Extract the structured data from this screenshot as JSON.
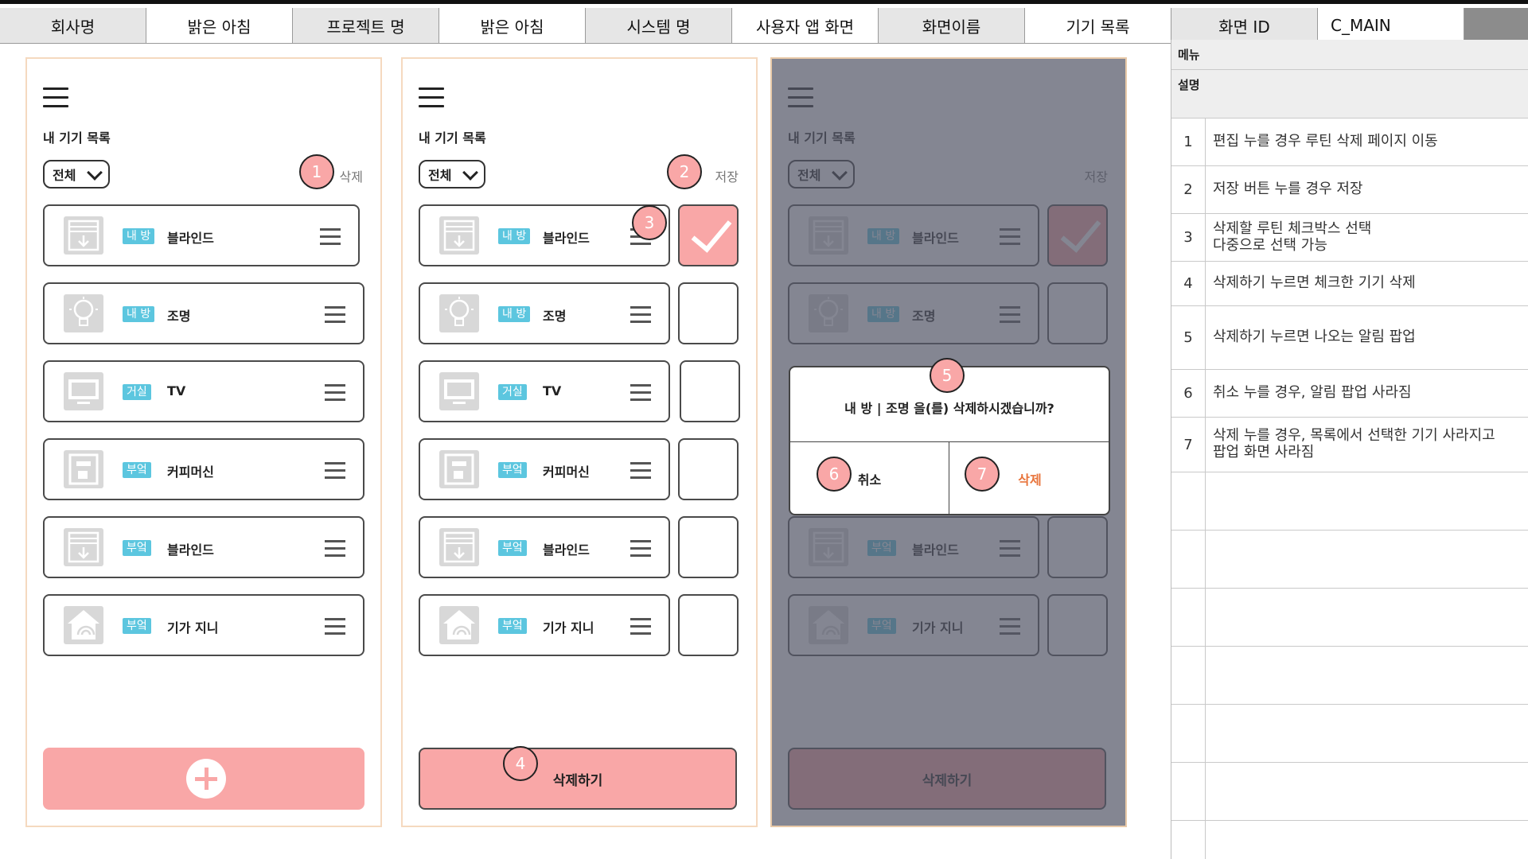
{
  "header": {
    "company_label": "회사명",
    "company_value": "밝은 아침",
    "project_label": "프로젝트 명",
    "project_value": "밝은 아침",
    "system_label": "시스템 명",
    "system_value": "사용자 앱 화면",
    "screen_name_label": "화면이름",
    "screen_name_value": "기기 목록",
    "screen_id_label": "화면 ID",
    "screen_id_value": "C_MAIN"
  },
  "screens": [
    {
      "title": "내 기기 목록",
      "filter": "전체",
      "top_action": "삭제",
      "devices": [
        {
          "room": "내 방",
          "name": "블라인드",
          "icon": "blinds-icon"
        },
        {
          "room": "내 방",
          "name": "조명",
          "icon": "lightbulb-icon"
        },
        {
          "room": "거실",
          "name": "TV",
          "icon": "tv-icon"
        },
        {
          "room": "부엌",
          "name": "커피머신",
          "icon": "coffee-machine-icon"
        },
        {
          "room": "부엌",
          "name": "블라인드",
          "icon": "blinds-icon"
        },
        {
          "room": "부엌",
          "name": "기가 지니",
          "icon": "smart-home-icon"
        }
      ],
      "bottom_button": "add"
    },
    {
      "title": "내 기기 목록",
      "filter": "전체",
      "top_action": "저장",
      "devices": [
        {
          "room": "내 방",
          "name": "블라인드",
          "checked": true
        },
        {
          "room": "내 방",
          "name": "조명",
          "checked": false
        },
        {
          "room": "거실",
          "name": "TV",
          "checked": false
        },
        {
          "room": "부엌",
          "name": "커피머신",
          "checked": false
        },
        {
          "room": "부엌",
          "name": "블라인드",
          "checked": false
        },
        {
          "room": "부엌",
          "name": "기가 지니",
          "checked": false
        }
      ],
      "bottom_button_label": "삭제하기"
    },
    {
      "title": "내 기기 목록",
      "filter": "전체",
      "top_action": "저장",
      "devices": [
        {
          "room": "내 방",
          "name": "블라인드",
          "checked": true
        },
        {
          "room": "내 방",
          "name": "조명",
          "checked": false
        },
        {
          "room": "부엌",
          "name": "블라인드",
          "checked": false
        },
        {
          "room": "부엌",
          "name": "기가 지니",
          "checked": false
        }
      ],
      "bottom_button_label": "삭제하기",
      "dialog": {
        "question": "내 방 | 조명 을(를) 삭제하시겠습니까?",
        "cancel": "취소",
        "confirm": "삭제"
      }
    }
  ],
  "markers": [
    "1",
    "2",
    "3",
    "4",
    "5",
    "6",
    "7"
  ],
  "spec": {
    "menu_label": "메뉴",
    "desc_label": "설명",
    "rows": [
      {
        "num": "1",
        "text": "편집 누를 경우 루틴 삭제 페이지 이동"
      },
      {
        "num": "2",
        "text": "저장 버튼 누를 경우 저장"
      },
      {
        "num": "3",
        "text": "삭제할 루틴 체크박스 선택\n다중으로 선택 가능"
      },
      {
        "num": "4",
        "text": "삭제하기 누르면 체크한 기기 삭제"
      },
      {
        "num": "5",
        "text": "삭제하기 누르면 나오는 알림 팝업"
      },
      {
        "num": "6",
        "text": "취소 누를 경우, 알림 팝업 사라짐"
      },
      {
        "num": "7",
        "text": "삭제 누를 경우, 목록에서 선택한 기기 사라지고\n팝업 화면 사라짐"
      }
    ]
  },
  "colors": {
    "accent_pink": "#f9a7a7",
    "room_tag": "#5cc6df",
    "delete_orange": "#e8743b",
    "overlay": "#545868"
  }
}
